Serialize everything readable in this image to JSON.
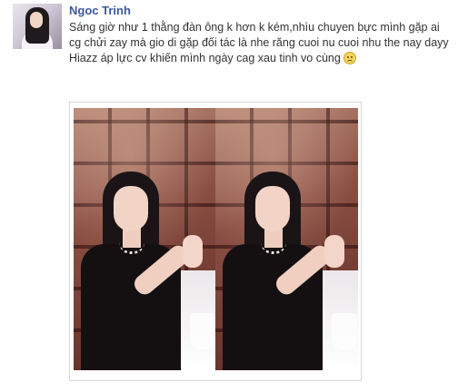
{
  "post": {
    "author": "Ngoc Trinh",
    "line1": "Sáng giờ như 1 thằng đàn ông k hơn k kém,nhìu chuyen bực mình gặp ai cg chửi zay mà gio di gặp đối tác là nhe răng cuoi nu cuoi nhu the nay dayy",
    "line2": "Hiazz áp lực cv khiến mình ngày cag xau tinh vo cùng",
    "emoticon": "frown-emoticon"
  },
  "photo": {
    "panels": 2
  },
  "colors": {
    "author_link": "#3b5998",
    "body_text": "#333333",
    "photo_border": "#d8d8d8"
  }
}
